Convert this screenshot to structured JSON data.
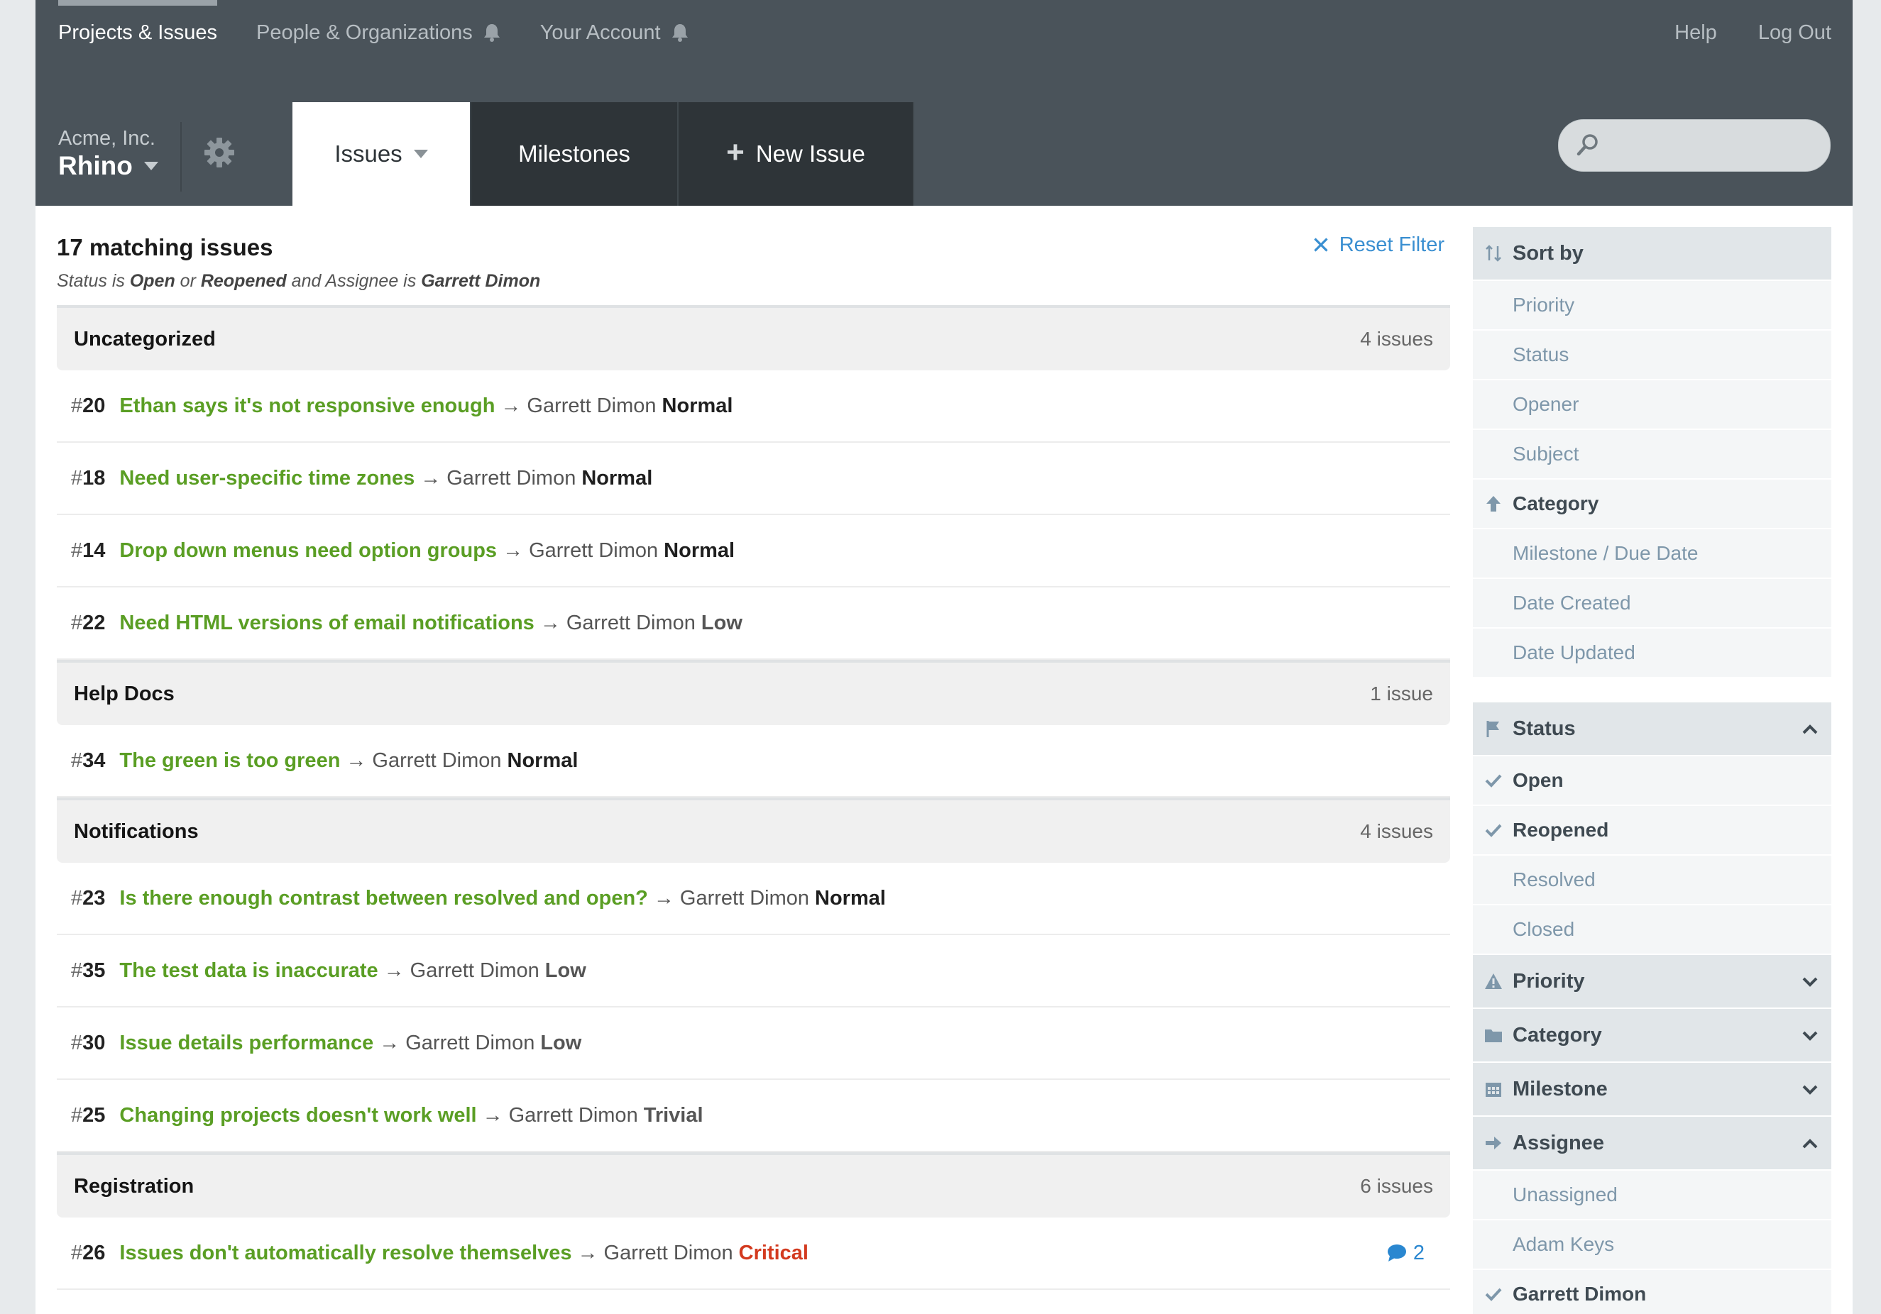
{
  "nav": {
    "projects": "Projects & Issues",
    "people": "People & Organizations",
    "account": "Your Account",
    "help": "Help",
    "logout": "Log Out"
  },
  "project": {
    "org": "Acme, Inc.",
    "name": "Rhino"
  },
  "tabs": {
    "issues": "Issues",
    "milestones": "Milestones",
    "new_issue": "New Issue"
  },
  "search": {
    "placeholder": ""
  },
  "summary": {
    "count_text": "17 matching issues",
    "filter_prefix": "Status is ",
    "filter_open": "Open",
    "filter_or": " or ",
    "filter_reopened": "Reopened",
    "filter_mid": " and Assignee is ",
    "filter_assignee": "Garrett Dimon",
    "reset": "Reset Filter"
  },
  "groups": [
    {
      "name": "Uncategorized",
      "count": "4 issues",
      "issues": [
        {
          "num": "20",
          "title": "Ethan says it's not responsive enough",
          "assignee": "Garrett Dimon",
          "priority": "Normal"
        },
        {
          "num": "18",
          "title": "Need user-specific time zones",
          "assignee": "Garrett Dimon",
          "priority": "Normal"
        },
        {
          "num": "14",
          "title": "Drop down menus need option groups",
          "assignee": "Garrett Dimon",
          "priority": "Normal"
        },
        {
          "num": "22",
          "title": "Need HTML versions of email notifications",
          "assignee": "Garrett Dimon",
          "priority": "Low"
        }
      ]
    },
    {
      "name": "Help Docs",
      "count": "1 issue",
      "issues": [
        {
          "num": "34",
          "title": "The green is too green",
          "assignee": "Garrett Dimon",
          "priority": "Normal"
        }
      ]
    },
    {
      "name": "Notifications",
      "count": "4 issues",
      "issues": [
        {
          "num": "23",
          "title": "Is there enough contrast between resolved and open?",
          "assignee": "Garrett Dimon",
          "priority": "Normal"
        },
        {
          "num": "35",
          "title": "The test data is inaccurate",
          "assignee": "Garrett Dimon",
          "priority": "Low"
        },
        {
          "num": "30",
          "title": "Issue details performance",
          "assignee": "Garrett Dimon",
          "priority": "Low"
        },
        {
          "num": "25",
          "title": "Changing projects doesn't work well",
          "assignee": "Garrett Dimon",
          "priority": "Trivial"
        }
      ]
    },
    {
      "name": "Registration",
      "count": "6 issues",
      "issues": [
        {
          "num": "26",
          "title": "Issues don't automatically resolve themselves",
          "assignee": "Garrett Dimon",
          "priority": "Critical",
          "comments": "2"
        }
      ]
    }
  ],
  "sidebar": {
    "sort": {
      "label": "Sort by",
      "items": [
        "Priority",
        "Status",
        "Opener",
        "Subject",
        "Category",
        "Milestone / Due Date",
        "Date Created",
        "Date Updated"
      ]
    },
    "status": {
      "label": "Status",
      "items": [
        "Open",
        "Reopened",
        "Resolved",
        "Closed"
      ]
    },
    "priority": {
      "label": "Priority"
    },
    "category": {
      "label": "Category"
    },
    "milestone": {
      "label": "Milestone"
    },
    "assignee": {
      "label": "Assignee",
      "items": [
        "Unassigned",
        "Adam Keys",
        "Garrett Dimon"
      ]
    }
  },
  "colors": {
    "accent_green": "#5a9e24",
    "link_blue": "#3a8fd1",
    "critical_red": "#d33a1f",
    "topbar": "#4a535a"
  }
}
